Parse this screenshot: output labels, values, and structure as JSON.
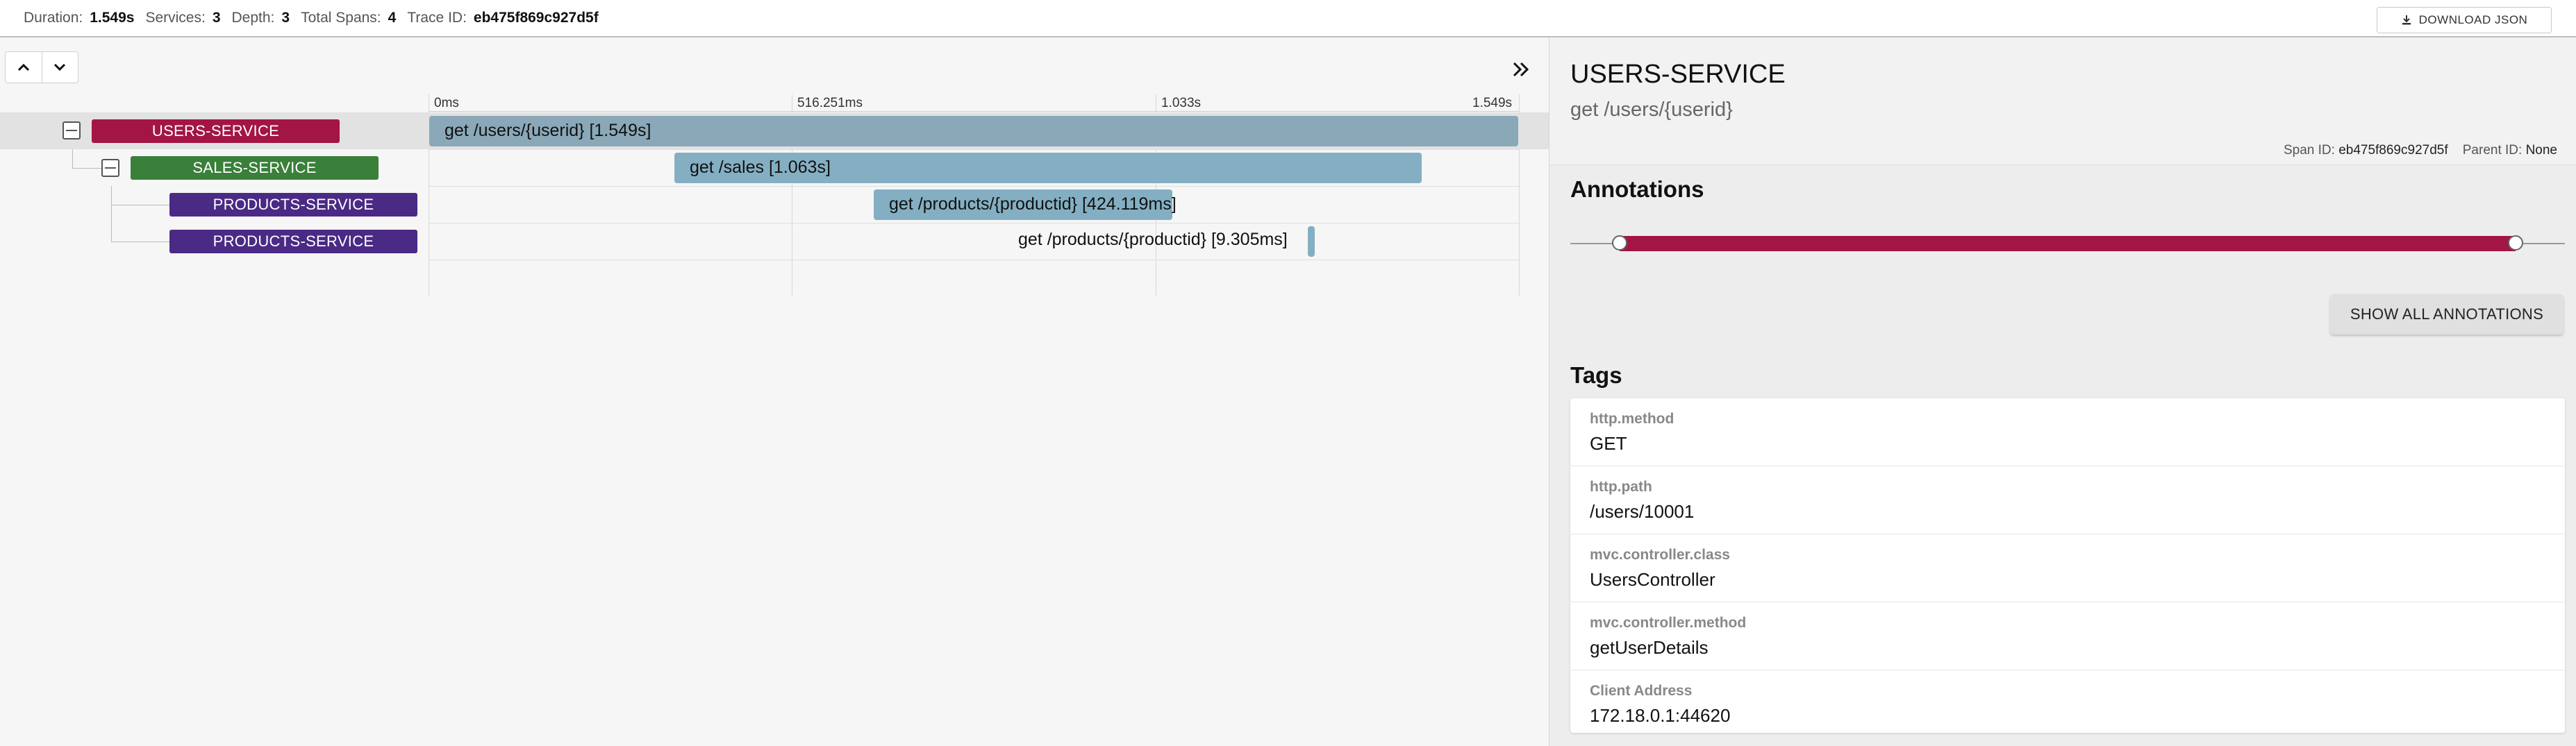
{
  "header": {
    "stats": [
      {
        "label": "Duration:",
        "value": "1.549s"
      },
      {
        "label": "Services:",
        "value": "3"
      },
      {
        "label": "Depth:",
        "value": "3"
      },
      {
        "label": "Total Spans:",
        "value": "4"
      },
      {
        "label": "Trace ID:",
        "value": "eb475f869c927d5f"
      }
    ],
    "download_label": "DOWNLOAD JSON",
    "download_icon": "download-icon"
  },
  "timeline": {
    "nav_icons": [
      "chevron-up-icon",
      "chevron-down-icon"
    ],
    "expand_icon": "double-chevron-right-icon",
    "ticks": [
      "0ms",
      "516.251ms",
      "1.033s",
      "1.549s"
    ],
    "spans": [
      {
        "service": "USERS-SERVICE",
        "name": "get /users/{userid} [1.549s]",
        "color": "#a31545",
        "bar_color": "#8aa8b8"
      },
      {
        "service": "SALES-SERVICE",
        "name": "get /sales [1.063s]",
        "color": "#3a7f3a",
        "bar_color": "#84afc3"
      },
      {
        "service": "PRODUCTS-SERVICE",
        "name": "get /products/{productid} [424.119ms]",
        "color": "#4a2a85",
        "bar_color": "#84afc3"
      },
      {
        "service": "PRODUCTS-SERVICE",
        "name": "get /products/{productid} [9.305ms]",
        "color": "#4a2a85",
        "bar_color": "#84afc3"
      }
    ]
  },
  "detail": {
    "service": "USERS-SERVICE",
    "span_name": "get /users/{userid}",
    "span_id_label": "Span ID:",
    "span_id": "eb475f869c927d5f",
    "parent_id_label": "Parent ID:",
    "parent_id": "None",
    "annotations_title": "Annotations",
    "annotation_color": "#a31545",
    "show_all_label": "SHOW ALL ANNOTATIONS",
    "tags_title": "Tags",
    "tags": [
      {
        "key": "http.method",
        "value": "GET"
      },
      {
        "key": "http.path",
        "value": "/users/10001"
      },
      {
        "key": "mvc.controller.class",
        "value": "UsersController"
      },
      {
        "key": "mvc.controller.method",
        "value": "getUserDetails"
      },
      {
        "key": "Client Address",
        "value": "172.18.0.1:44620"
      }
    ]
  }
}
